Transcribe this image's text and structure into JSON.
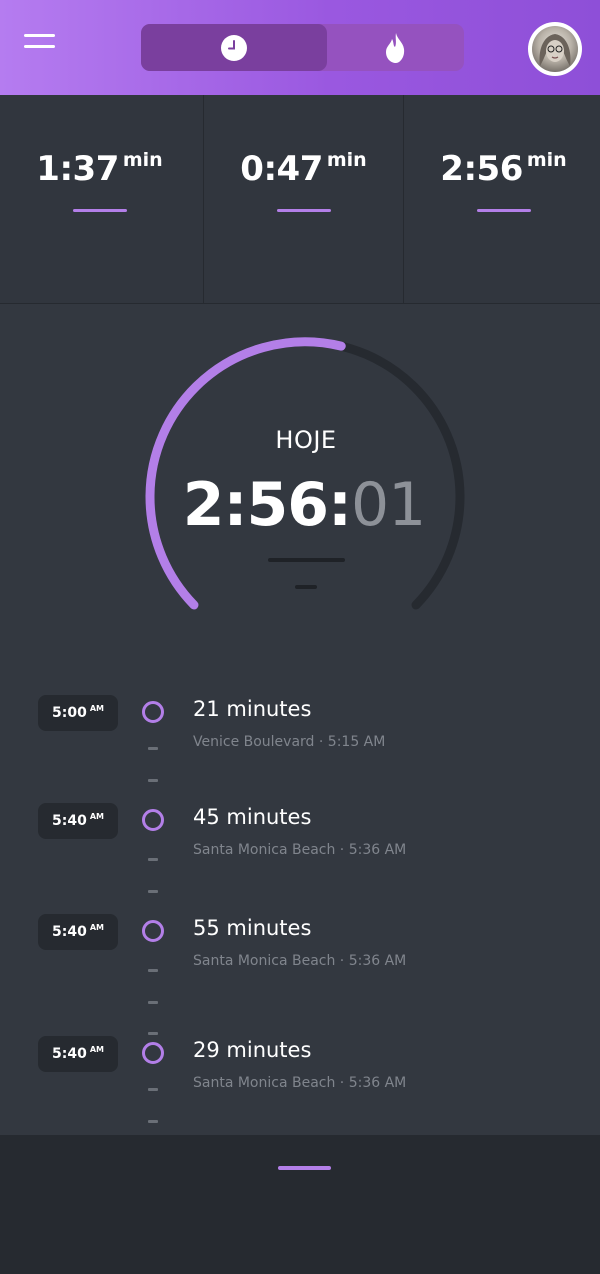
{
  "header": {
    "menu_icon": "hamburger-menu-icon",
    "tabs": [
      {
        "icon": "clock-icon",
        "active": true
      },
      {
        "icon": "flame-icon",
        "active": false
      }
    ],
    "avatar_icon": "user-avatar"
  },
  "stats": [
    {
      "value": "1:37",
      "unit": "min"
    },
    {
      "value": "0:47",
      "unit": "min"
    },
    {
      "value": "2:56",
      "unit": "min"
    }
  ],
  "gauge": {
    "title": "HOJE",
    "time_main": "2:56:",
    "time_seconds": "01",
    "progress_fraction": 0.55
  },
  "timeline": [
    {
      "time": "5:00",
      "ampm": "AM",
      "title": "21 minutes",
      "subtitle": "Venice Boulevard · 5:15 AM"
    },
    {
      "time": "5:40",
      "ampm": "AM",
      "title": "45 minutes",
      "subtitle": "Santa Monica Beach  ·  5:36 AM"
    },
    {
      "time": "5:40",
      "ampm": "AM",
      "title": "55 minutes",
      "subtitle": "Santa Monica Beach  ·  5:36 AM"
    },
    {
      "time": "5:40",
      "ampm": "AM",
      "title": "29 minutes",
      "subtitle": "Santa Monica Beach  ·  5:36 AM"
    }
  ],
  "colors": {
    "accent": "#b37fe8",
    "header_start": "#b57cf0",
    "header_end": "#8e4fd8",
    "background": "#333840",
    "track": "#262a30"
  }
}
